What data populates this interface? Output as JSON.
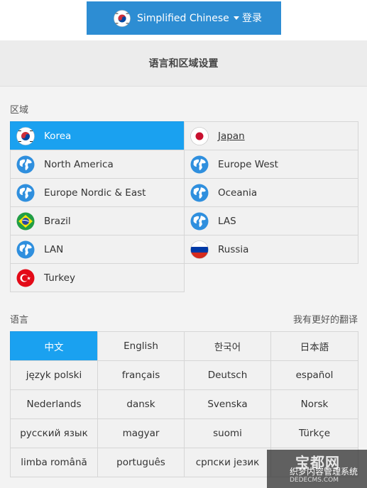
{
  "topbar": {
    "language_label": "Simplified Chinese",
    "login_label": "登录"
  },
  "panel": {
    "title": "语言和区域设置",
    "region_label": "区域",
    "language_label": "语言",
    "better_translation": "我有更好的翻译"
  },
  "regions": [
    {
      "label": "Korea",
      "icon": "korea-flag-icon",
      "active": true
    },
    {
      "label": "Japan",
      "icon": "japan-flag-icon",
      "active": false,
      "underline": true
    },
    {
      "label": "North America",
      "icon": "globe-icon",
      "active": false
    },
    {
      "label": "Europe West",
      "icon": "globe-icon",
      "active": false
    },
    {
      "label": "Europe Nordic & East",
      "icon": "globe-icon",
      "active": false
    },
    {
      "label": "Oceania",
      "icon": "globe-icon",
      "active": false
    },
    {
      "label": "Brazil",
      "icon": "brazil-flag-icon",
      "active": false
    },
    {
      "label": "LAS",
      "icon": "globe-icon",
      "active": false
    },
    {
      "label": "LAN",
      "icon": "globe-icon",
      "active": false
    },
    {
      "label": "Russia",
      "icon": "russia-flag-icon",
      "active": false
    },
    {
      "label": "Turkey",
      "icon": "turkey-flag-icon",
      "active": false
    }
  ],
  "languages": [
    {
      "label": "中文",
      "active": true
    },
    {
      "label": "English"
    },
    {
      "label": "한국어"
    },
    {
      "label": "日本語"
    },
    {
      "label": "język polski"
    },
    {
      "label": "français"
    },
    {
      "label": "Deutsch"
    },
    {
      "label": "español"
    },
    {
      "label": "Nederlands"
    },
    {
      "label": "dansk"
    },
    {
      "label": "Svenska"
    },
    {
      "label": "Norsk"
    },
    {
      "label": "русский язык"
    },
    {
      "label": "magyar"
    },
    {
      "label": "suomi"
    },
    {
      "label": "Türkçe"
    },
    {
      "label": "limba română"
    },
    {
      "label": "português"
    },
    {
      "label": "српски језик"
    },
    {
      "label": ""
    }
  ],
  "watermark": {
    "big": "宝都网",
    "mid": "织梦内容管理系统",
    "small": "DEDECMS.COM"
  },
  "colors": {
    "topbar": "#2d8dd3",
    "active": "#1aa1f0",
    "panel": "#f3f3f3"
  }
}
